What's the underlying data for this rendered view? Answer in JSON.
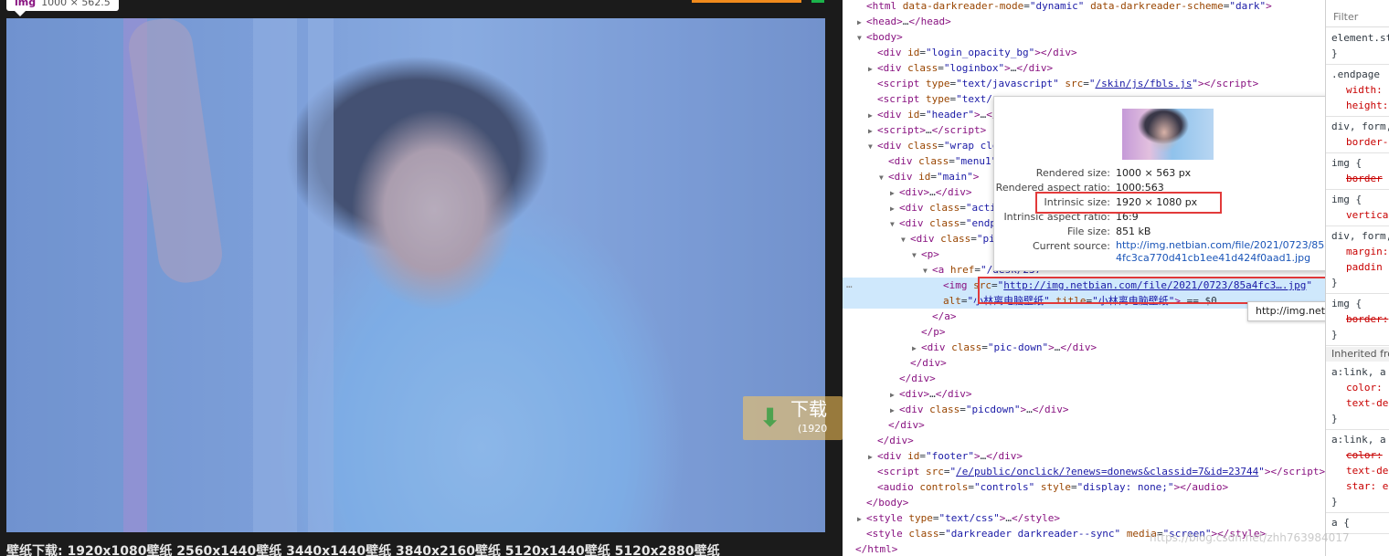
{
  "page": {
    "tag_name": "img",
    "tag_size": "1000 × 562.5",
    "download_label": "下载",
    "download_sub": "(1920",
    "footer_text": "壁纸下载: 1920x1080壁纸 2560x1440壁纸 3440x1440壁纸 3840x2160壁纸 5120x1440壁纸 5120x2880壁纸"
  },
  "elements": {
    "lines": [
      {
        "indent": 1,
        "tri": "",
        "html": "<span class='tg'>&lt;html</span> <span class='an'>data-darkreader-mode</span>=<span class='av'>\"dynamic\"</span> <span class='an'>data-darkreader-scheme</span>=<span class='av'>\"dark\"</span><span class='tg'>&gt;</span>"
      },
      {
        "indent": 1,
        "tri": "▶",
        "html": "<span class='tg'>&lt;head&gt;</span>…<span class='tg'>&lt;/head&gt;</span>"
      },
      {
        "indent": 1,
        "tri": "▼",
        "html": "<span class='tg'>&lt;body&gt;</span>"
      },
      {
        "indent": 2,
        "tri": "",
        "html": "<span class='tg'>&lt;div</span> <span class='an'>id</span>=<span class='av'>\"login_opacity_bg\"</span><span class='tg'>&gt;&lt;/div&gt;</span>"
      },
      {
        "indent": 2,
        "tri": "▶",
        "html": "<span class='tg'>&lt;div</span> <span class='an'>class</span>=<span class='av'>\"loginbox\"</span><span class='tg'>&gt;</span>…<span class='tg'>&lt;/div&gt;</span>"
      },
      {
        "indent": 2,
        "tri": "",
        "html": "<span class='tg'>&lt;script</span> <span class='an'>type</span>=<span class='av'>\"text/javascript\"</span> <span class='an'>src</span>=<span class='av'>\"<span class='lnk'>/skin/js/fbls.js</span>\"</span><span class='tg'>&gt;&lt;/script&gt;</span>"
      },
      {
        "indent": 2,
        "tri": "",
        "html": "<span class='tg'>&lt;script</span> <span class='an'>type</span>=<span class='av'>\"text/</span>"
      },
      {
        "indent": 2,
        "tri": "▶",
        "html": "<span class='tg'>&lt;div</span> <span class='an'>id</span>=<span class='av'>\"header\"</span><span class='tg'>&gt;</span>…<span class='tg'>&lt;/</span>"
      },
      {
        "indent": 2,
        "tri": "▶",
        "html": "<span class='tg'>&lt;script&gt;</span>…<span class='tg'>&lt;/script&gt;</span>"
      },
      {
        "indent": 2,
        "tri": "▼",
        "html": "<span class='tg'>&lt;div</span> <span class='an'>class</span>=<span class='av'>\"wrap cle</span>"
      },
      {
        "indent": 3,
        "tri": "",
        "html": "<span class='tg'>&lt;div</span> <span class='an'>class</span>=<span class='av'>\"menu1\"</span>"
      },
      {
        "indent": 3,
        "tri": "▼",
        "html": "<span class='tg'>&lt;div</span> <span class='an'>id</span>=<span class='av'>\"main\"</span><span class='tg'>&gt;</span>"
      },
      {
        "indent": 4,
        "tri": "▶",
        "html": "<span class='tg'>&lt;div&gt;</span>…<span class='tg'>&lt;/div&gt;</span>"
      },
      {
        "indent": 4,
        "tri": "▶",
        "html": "<span class='tg'>&lt;div</span> <span class='an'>class</span>=<span class='av'>\"acti</span>"
      },
      {
        "indent": 4,
        "tri": "▼",
        "html": "<span class='tg'>&lt;div</span> <span class='an'>class</span>=<span class='av'>\"endp</span>"
      },
      {
        "indent": 5,
        "tri": "▼",
        "html": "<span class='tg'>&lt;div</span> <span class='an'>class</span>=<span class='av'>\"pi</span>"
      },
      {
        "indent": 6,
        "tri": "▼",
        "html": "<span class='tg'>&lt;p&gt;</span>"
      },
      {
        "indent": 7,
        "tri": "▼",
        "html": "<span class='tg'>&lt;a</span> <span class='an'>href</span>=<span class='av'>\"/desk/237</span>"
      },
      {
        "indent": 8,
        "tri": "",
        "sel": true,
        "html": "<span class='tg'>&lt;img</span> <span class='an'>src</span>=<span class='av'>\"<span class='lnk'>http://img.netbian.com/file/2021/0723/85a4fc3….jpg</span>\"</span>"
      },
      {
        "indent": 8,
        "tri": "",
        "sel": true,
        "html": "<span class='an'>alt</span>=<span class='av'>\"小林离电脑壁纸\"</span> <span class='an'>title</span>=<span class='av'>\"小林离电脑壁纸\"</span><span class='tg'>&gt;</span> <span class='txt'>== $0</span>"
      },
      {
        "indent": 7,
        "tri": "",
        "html": "<span class='tg'>&lt;/a&gt;</span>"
      },
      {
        "indent": 6,
        "tri": "",
        "html": "<span class='tg'>&lt;/p&gt;</span>"
      },
      {
        "indent": 6,
        "tri": "▶",
        "html": "<span class='tg'>&lt;div</span> <span class='an'>class</span>=<span class='av'>\"pic-down\"</span><span class='tg'>&gt;</span>…<span class='tg'>&lt;/div&gt;</span>"
      },
      {
        "indent": 5,
        "tri": "",
        "html": "<span class='tg'>&lt;/div&gt;</span>"
      },
      {
        "indent": 4,
        "tri": "",
        "html": "<span class='tg'>&lt;/div&gt;</span>"
      },
      {
        "indent": 4,
        "tri": "▶",
        "html": "<span class='tg'>&lt;div&gt;</span>…<span class='tg'>&lt;/div&gt;</span>"
      },
      {
        "indent": 4,
        "tri": "▶",
        "html": "<span class='tg'>&lt;div</span> <span class='an'>class</span>=<span class='av'>\"picdown\"</span><span class='tg'>&gt;</span>…<span class='tg'>&lt;/div&gt;</span>"
      },
      {
        "indent": 3,
        "tri": "",
        "html": "<span class='tg'>&lt;/div&gt;</span>"
      },
      {
        "indent": 2,
        "tri": "",
        "html": "<span class='tg'>&lt;/div&gt;</span>"
      },
      {
        "indent": 2,
        "tri": "▶",
        "html": "<span class='tg'>&lt;div</span> <span class='an'>id</span>=<span class='av'>\"footer\"</span><span class='tg'>&gt;</span>…<span class='tg'>&lt;/div&gt;</span>"
      },
      {
        "indent": 2,
        "tri": "",
        "html": "<span class='tg'>&lt;script</span> <span class='an'>src</span>=<span class='av'>\"<span class='lnk'>/e/public/onclick/?enews=donews&amp;classid=7&amp;id=23744</span>\"</span><span class='tg'>&gt;&lt;/script&gt;</span>"
      },
      {
        "indent": 2,
        "tri": "",
        "html": "<span class='tg'>&lt;audio</span> <span class='an'>controls</span>=<span class='av'>\"controls\"</span> <span class='an'>style</span>=<span class='av'>\"display: none;\"</span><span class='tg'>&gt;&lt;/audio&gt;</span>"
      },
      {
        "indent": 1,
        "tri": "",
        "html": "<span class='tg'>&lt;/body&gt;</span>"
      },
      {
        "indent": 1,
        "tri": "▶",
        "html": "<span class='tg'>&lt;style</span> <span class='an'>type</span>=<span class='av'>\"text/css\"</span><span class='tg'>&gt;</span>…<span class='tg'>&lt;/style&gt;</span>"
      },
      {
        "indent": 1,
        "tri": "",
        "html": "<span class='tg'>&lt;style</span> <span class='an'>class</span>=<span class='av'>\"darkreader darkreader--sync\"</span> <span class='an'>media</span>=<span class='av'>\"screen\"</span><span class='tg'>&gt;&lt;/style&gt;</span>"
      },
      {
        "indent": 0,
        "tri": "",
        "html": "<span class='tg'>&lt;/html&gt;</span>"
      }
    ],
    "ellipsis": "…"
  },
  "tooltip": {
    "rows": [
      {
        "key": "Rendered size:",
        "val": "1000 × 563 px"
      },
      {
        "key": "Rendered aspect ratio:",
        "val": "1000:563"
      },
      {
        "key": "Intrinsic size:",
        "val": "1920 × 1080 px"
      },
      {
        "key": "Intrinsic aspect ratio:",
        "val": "16:9"
      },
      {
        "key": "File size:",
        "val": "851 kB"
      },
      {
        "key": "Current source:",
        "val": "http://img.netbian.com/file/2021/0723/85a4fc3ca770d41cb1ee41d424f0aad1.jpg",
        "url": true
      }
    ]
  },
  "url_hint": "http://img.netbian.com/file/",
  "styles": {
    "filter_placeholder": "Filter",
    "blocks": [
      {
        "sel": "element.st",
        "props": [],
        "close": "}"
      },
      {
        "sel": ".endpage",
        "props": [
          {
            "t": "width:",
            "strike": false
          },
          {
            "t": "height:",
            "strike": false
          }
        ],
        "close": ""
      },
      {
        "sel": "div, form,",
        "props": [
          {
            "t": "border-",
            "strike": false
          }
        ],
        "close": ""
      },
      {
        "sel": "img {",
        "props": [
          {
            "t": "border",
            "strike": true
          }
        ],
        "close": ""
      },
      {
        "sel": "img {",
        "props": [
          {
            "t": "vertica",
            "strike": false
          }
        ],
        "close": ""
      },
      {
        "sel": "div, form,",
        "props": [
          {
            "t": "margin:",
            "strike": false
          },
          {
            "t": "paddin",
            "strike": false
          }
        ],
        "close": "}"
      },
      {
        "sel": "img {",
        "props": [
          {
            "t": "border:",
            "strike": true
          }
        ],
        "close": "}"
      }
    ],
    "inherited_label": "Inherited fro",
    "link_blocks": [
      {
        "sel": "a:link, a",
        "props": [
          {
            "t": "color:",
            "strike": false
          },
          {
            "t": "text-de",
            "strike": false
          }
        ],
        "close": "}"
      },
      {
        "sel": "a:link, a",
        "props": [
          {
            "t": "color:",
            "strike": true
          },
          {
            "t": "text-de",
            "strike": false
          },
          {
            "t": "star: e",
            "strike": false
          }
        ],
        "close": "}"
      },
      {
        "sel": "a {",
        "props": [],
        "close": ""
      }
    ]
  },
  "watermark": "https://blog.csdn.net/zhh763984017"
}
